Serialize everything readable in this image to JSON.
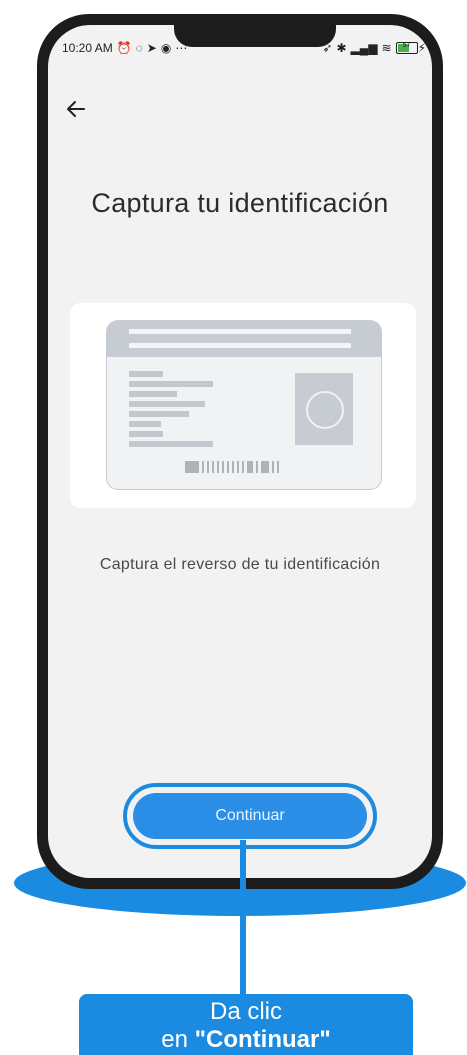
{
  "status_bar": {
    "time": "10:20 AM",
    "left_icons": [
      "alarm-icon",
      "whatsapp-icon",
      "send-icon",
      "messenger-icon",
      "more-icon"
    ],
    "right_icons": [
      "location-icon",
      "bluetooth-icon",
      "signal-icon",
      "wifi-icon",
      "battery-icon"
    ],
    "battery_level": "57"
  },
  "header": {
    "back_icon": "arrow-left-icon"
  },
  "main": {
    "title": "Captura tu identificación",
    "id_illustration": "id-card-back-icon",
    "instruction": "Captura el reverso de tu identificación",
    "continue_label": "Continuar"
  },
  "callout": {
    "line1": "Da clic",
    "line2_prefix": "en ",
    "line2_bold": "\"Continuar\""
  },
  "colors": {
    "accent": "#1a8be0",
    "button": "#2b8ee6",
    "screen_bg": "#f2f2f2",
    "card_bg": "#ffffff",
    "phone_frame": "#1c1c1c"
  }
}
